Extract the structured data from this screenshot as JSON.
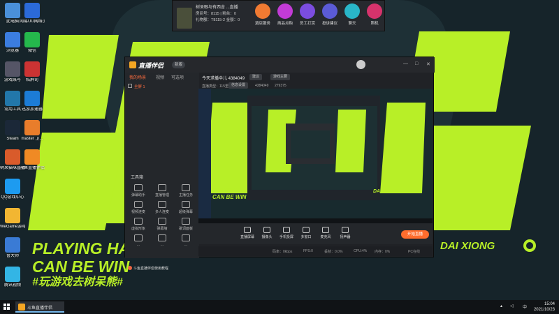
{
  "desktop": {
    "icons": [
      {
        "label": "此电脑",
        "icon": "computer-icon",
        "color": "#4a90d9",
        "col": 0,
        "row": 0
      },
      {
        "label": "网易UU网络加速",
        "icon": "uu-icon",
        "color": "#2b6ad8",
        "col": 1,
        "row": 0
      },
      {
        "label": "浏览器",
        "icon": "browser-icon",
        "color": "#3b7de0",
        "col": 0,
        "row": 1
      },
      {
        "label": "微信",
        "icon": "wechat-icon",
        "color": "#25b84c",
        "col": 1,
        "row": 1
      },
      {
        "label": "游戏账号",
        "icon": "game-icon",
        "color": "#556",
        "col": 0,
        "row": 2
      },
      {
        "label": "粘屏司",
        "icon": "glue-icon",
        "color": "#c33",
        "col": 1,
        "row": 2
      },
      {
        "label": "常用工具",
        "icon": "tools-icon",
        "color": "#27a",
        "col": 0,
        "row": 3
      },
      {
        "label": "迅游加速器",
        "icon": "speedup-icon",
        "color": "#1c7cd6",
        "col": 1,
        "row": 3
      },
      {
        "label": "Steam",
        "icon": "steam-icon",
        "color": "#1b2838",
        "col": 0,
        "row": 4
      },
      {
        "label": "master 卫...",
        "icon": "master-icon",
        "color": "#e87d2b",
        "col": 1,
        "row": 4
      },
      {
        "label": "树呆猫咪直播",
        "icon": "cat-icon",
        "color": "#d95b2b",
        "col": 0,
        "row": 5
      },
      {
        "label": "斗鱼直播伴侣",
        "icon": "douyu-icon",
        "color": "#f08a24",
        "col": 1,
        "row": 5
      },
      {
        "label": "QQ游戏中心",
        "icon": "qq-icon",
        "color": "#1d9bf0",
        "col": 0,
        "row": 6
      },
      {
        "label": "WeGame游戏平台",
        "icon": "wegame-icon",
        "color": "#f2b632",
        "col": 0,
        "row": 7
      },
      {
        "label": "鲁大师",
        "icon": "ludashi-icon",
        "color": "#3a7bd5",
        "col": 0,
        "row": 8
      },
      {
        "label": "腾讯视频",
        "icon": "video-icon",
        "color": "#33b5e5",
        "col": 0,
        "row": 9
      }
    ],
    "banner_line1": "PLAYING HA",
    "banner_line2": "CAN BE WIN",
    "banner_tag": "#玩游戏去树呆熊#",
    "brand_right": "DAI XIONG"
  },
  "top_panel": {
    "title": "树呆眼与有西吉 ...直播",
    "rows": [
      "房间号：8115 | 粉丝：0",
      "礼物额：T8115-2 金额：0"
    ],
    "tools": [
      {
        "label": "酒店服务",
        "icon": "hotel-icon",
        "color": "#f07a32"
      },
      {
        "label": "商品点购",
        "icon": "bag-icon",
        "color": "#c23bd6"
      },
      {
        "label": "员工打赏",
        "icon": "star-icon",
        "color": "#7b4de0"
      },
      {
        "label": "投诉建议",
        "icon": "feedback-icon",
        "color": "#5b5bd6"
      },
      {
        "label": "聊天",
        "icon": "chat-icon",
        "color": "#29b6c9"
      },
      {
        "label": "照机",
        "icon": "game-pad-icon",
        "color": "#d6336c"
      }
    ]
  },
  "app": {
    "logo": "直播伴侣",
    "version": "新版",
    "controls": [
      "—",
      "□",
      "✕"
    ],
    "left_tabs": [
      "我的场景",
      "视频",
      "可选项"
    ],
    "scene_name": "全屏 1",
    "tools_title": "工具箱",
    "tools": [
      {
        "label": "弹幕助手",
        "icon": "danmu-icon"
      },
      {
        "label": "直播管理",
        "icon": "manage-icon"
      },
      {
        "label": "主播任务",
        "icon": "task-icon"
      },
      {
        "label": "视频连麦",
        "icon": "video-link-icon"
      },
      {
        "label": "多人连麦",
        "icon": "multi-link-icon"
      },
      {
        "label": "超级弹幕",
        "icon": "super-danmu-icon"
      },
      {
        "label": "虚拟形象",
        "icon": "avatar-icon"
      },
      {
        "label": "弹幕墙",
        "icon": "wall-icon"
      },
      {
        "label": "歌词面板",
        "icon": "lyrics-icon"
      },
      {
        "label": "...",
        "icon": "more-icon"
      },
      {
        "label": "...",
        "icon": "more2-icon"
      },
      {
        "label": "...",
        "icon": "more3-icon"
      }
    ],
    "warning": "斗鱼直播伴侣使用教程",
    "game_info": "今天求播伞儿 4384049",
    "status_pill": "建议",
    "category": "游戏主要",
    "room_label": "直播类型：115里程",
    "room_pill": "信息设置",
    "room_id": "4384049",
    "room_count": "279375",
    "bottom_buttons": [
      {
        "label": "直播屏幕",
        "icon": "screen-icon"
      },
      {
        "label": "摄像头",
        "icon": "camera-icon"
      },
      {
        "label": "手机投屏",
        "icon": "phone-icon"
      },
      {
        "label": "多窗口",
        "icon": "window-icon"
      },
      {
        "label": "麦克风",
        "icon": "mic-icon"
      },
      {
        "label": "扬声器",
        "icon": "speaker-icon"
      }
    ],
    "start_button": "开始直播",
    "status": [
      "码率：0kbps",
      "FPS:0",
      "丢帧：0.0%",
      "CPU:4%",
      "内存：0%",
      "PC在线"
    ]
  },
  "taskbar": {
    "app_label": "斗鱼直播伴侣",
    "lang": "中",
    "time": "15:04",
    "date": "2021/10/23"
  }
}
